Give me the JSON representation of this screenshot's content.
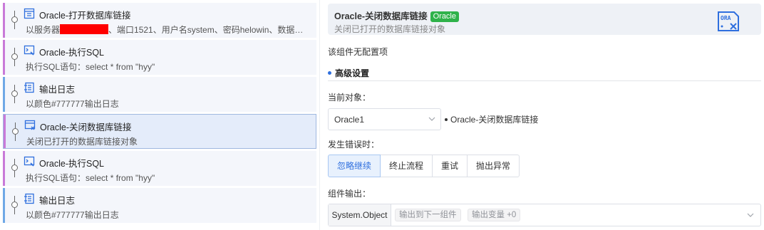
{
  "steps": [
    {
      "title": "Oracle-打开数据库链接",
      "desc_prefix": "以服务器",
      "desc_suffix": "、端口1521、用户名system、密码helowin、数据…",
      "icon": "database-open-icon",
      "color": "#c97ad8"
    },
    {
      "title": "Oracle-执行SQL",
      "desc": "执行SQL语句：select * from \"hyy\"",
      "icon": "sql-exec-icon",
      "color": "#c97ad8"
    },
    {
      "title": "输出日志",
      "desc": "以颜色#777777输出日志",
      "icon": "log-output-icon",
      "color": "#6fa8e6"
    },
    {
      "title": "Oracle-关闭数据库链接",
      "desc": "关闭已打开的数据库链接对象",
      "icon": "database-close-icon",
      "color": "#c97ad8"
    },
    {
      "title": "Oracle-执行SQL",
      "desc": "执行SQL语句：select * from \"hyy\"",
      "icon": "sql-exec-icon",
      "color": "#c97ad8"
    },
    {
      "title": "输出日志",
      "desc": "以颜色#777777输出日志",
      "icon": "log-output-icon",
      "color": "#6fa8e6"
    }
  ],
  "panel": {
    "title": "Oracle-关闭数据库链接",
    "tag": "Oracle",
    "subtitle": "关闭已打开的数据库链接对象",
    "icon": "oracle-ora-icon",
    "no_config": "该组件无配置项",
    "advanced_header": "高级设置",
    "current_object_label": "当前对象：",
    "current_object_value": "Oracle1",
    "current_object_target": "Oracle-关闭数据库链接",
    "on_error_label": "发生错误时：",
    "on_error_options": [
      "忽略继续",
      "终止流程",
      "重试",
      "抛出异常"
    ],
    "on_error_selected": "忽略继续",
    "output_label": "组件输出：",
    "output_type": "System.Object",
    "output_chip_1": "输出到下一组件",
    "output_chip_2": "输出变量 +0"
  },
  "colors": {
    "accent": "#2f6fde",
    "tag_green": "#2fb24a",
    "redaction": "#ff0000"
  }
}
